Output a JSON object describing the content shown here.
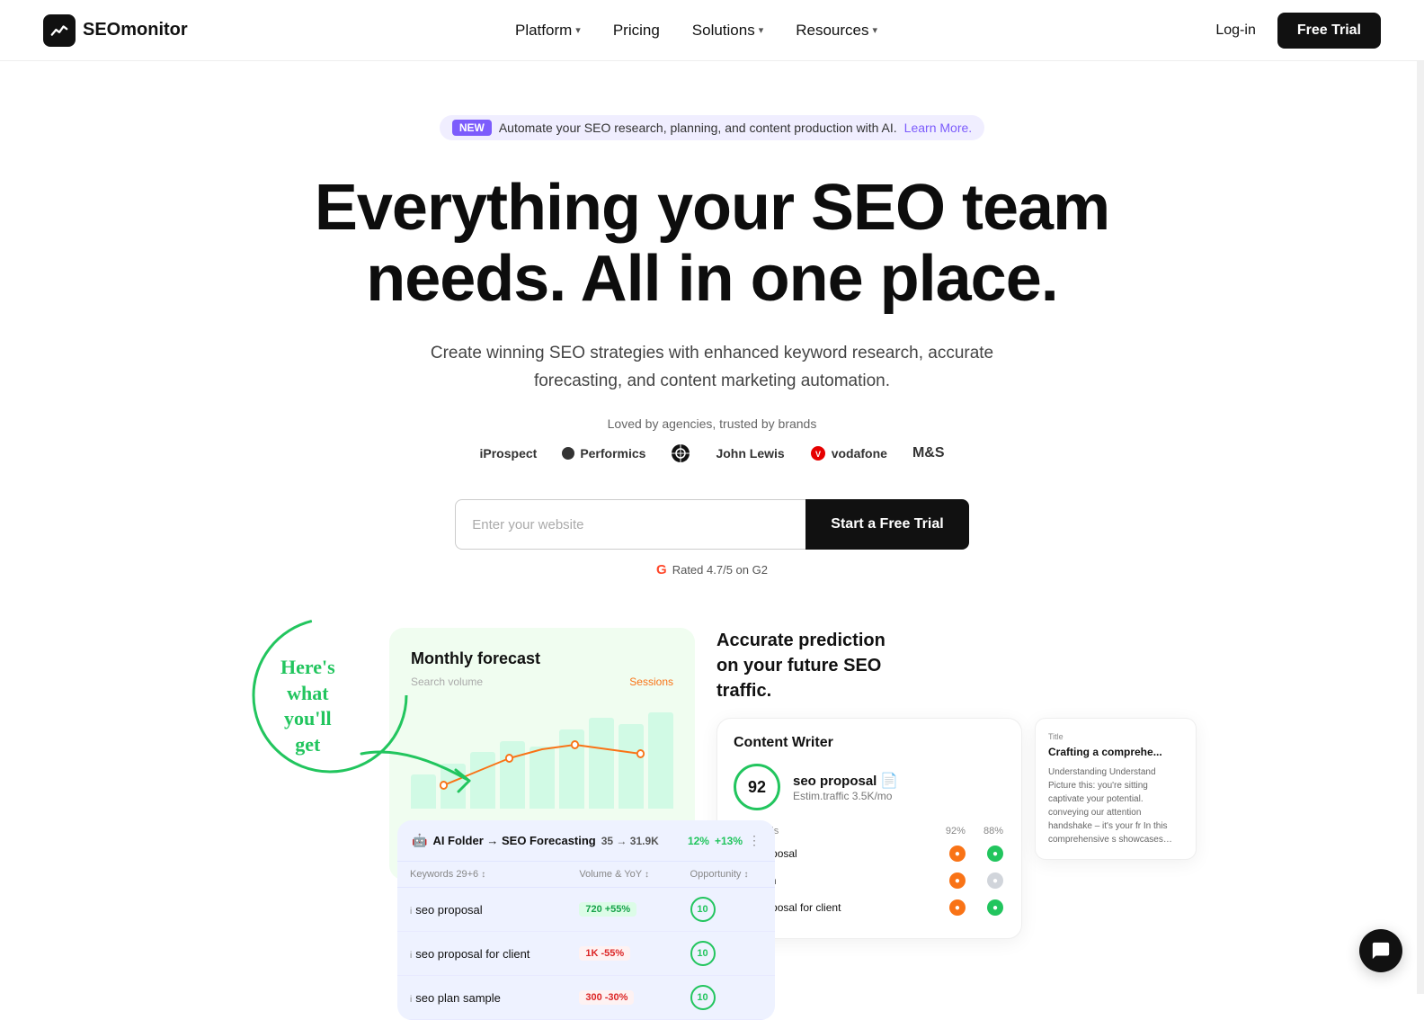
{
  "nav": {
    "logo_text": "SEOmonitor",
    "links": [
      {
        "label": "Platform",
        "has_dropdown": true
      },
      {
        "label": "Pricing",
        "has_dropdown": false
      },
      {
        "label": "Solutions",
        "has_dropdown": true
      },
      {
        "label": "Resources",
        "has_dropdown": true
      }
    ],
    "login_label": "Log-in",
    "free_trial_label": "Free Trial"
  },
  "announcement": {
    "badge": "NEW",
    "text": "Automate your SEO research, planning, and content production with AI.",
    "link_text": "Learn More."
  },
  "hero": {
    "title_line1": "Everything your SEO team",
    "title_line2": "needs. All in one place.",
    "subtitle": "Create winning SEO strategies with enhanced keyword research, accurate forecasting, and content marketing automation.",
    "trust_text": "Loved by agencies, trusted by brands",
    "brands": [
      "iProspect",
      "Performics",
      "⚙",
      "John Lewis",
      "vodafone",
      "M&S"
    ]
  },
  "cta": {
    "input_placeholder": "Enter your website",
    "button_label": "Start a Free Trial",
    "g2_text": "Rated 4.7/5 on G2"
  },
  "handwritten": {
    "text": "Here's what you'll get",
    "arrow": "→"
  },
  "forecast_card": {
    "title": "Monthly forecast",
    "label_search": "Search volume",
    "label_sessions": "Sessions"
  },
  "seo_folder": {
    "title": "AI Folder → SEO Forecasting",
    "stats": "35 → 31.9K",
    "pct1": "12%",
    "pct2": "+13%",
    "col_keywords": "Keywords 29+6",
    "col_volume": "Volume & YoY",
    "col_opportunity": "Opportunity",
    "rows": [
      {
        "keyword": "seo proposal",
        "vol": "720",
        "vol_pct": "+55%",
        "vol_type": "green",
        "opp": "10"
      },
      {
        "keyword": "seo proposal for client",
        "vol": "1K",
        "vol_pct": "-55%",
        "vol_type": "red",
        "opp": "10"
      },
      {
        "keyword": "seo plan sample",
        "vol": "300",
        "vol_pct": "-30%",
        "vol_type": "red",
        "opp": "10"
      }
    ]
  },
  "accurate": {
    "line1": "Accurate prediction",
    "line2": "on your future SEO traffic."
  },
  "content_card": {
    "title": "Content Writer",
    "score": "92",
    "keyword": "seo proposal",
    "estim": "Estim.traffic 3.5K/mo",
    "col_keywords": "Keywords",
    "col_c1": "92%",
    "col_c2": "88%",
    "rows": [
      {
        "kw": "seo proposal",
        "dot1": "orange",
        "dot2": "green"
      },
      {
        "kw": "seo plan",
        "dot1": "orange",
        "dot2": "gray"
      },
      {
        "kw": "seo proposal for client",
        "dot1": "orange",
        "dot2": "green"
      }
    ]
  },
  "article_preview": {
    "title_label": "Title",
    "title": "Crafting a comprehe...",
    "body": "Understanding Understand\nPicture this: you're sitting captivate your potential. conveying our attention handshake – it's your fr\nIn this comprehensive s showcases your agency, presenting clear deliver competitive market. By clients but also lay the f"
  }
}
